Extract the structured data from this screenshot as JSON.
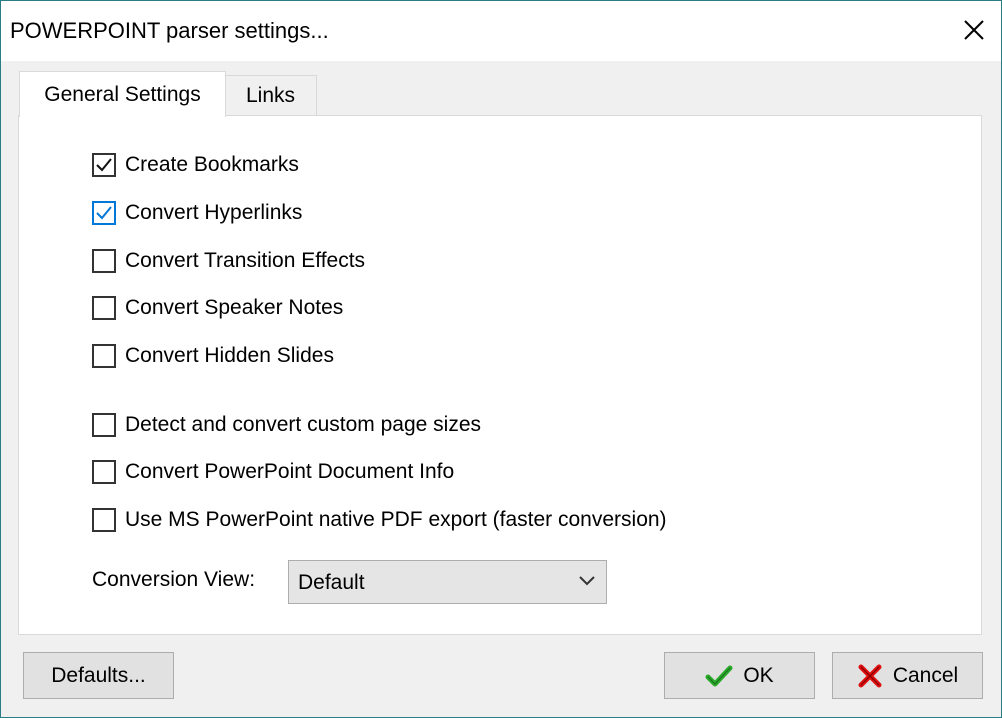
{
  "window": {
    "title": "POWERPOINT parser settings...",
    "close_icon": "close-icon"
  },
  "tabs": [
    {
      "label": "General Settings",
      "selected": true
    },
    {
      "label": "Links",
      "selected": false
    }
  ],
  "options": [
    {
      "label": "Create Bookmarks",
      "checked": true
    },
    {
      "label": "Convert Hyperlinks",
      "checked": true
    },
    {
      "label": "Convert Transition Effects",
      "checked": false
    },
    {
      "label": "Convert Speaker Notes",
      "checked": false
    },
    {
      "label": "Convert Hidden Slides",
      "checked": false
    },
    {
      "label": "Detect and convert custom page sizes",
      "checked": false
    },
    {
      "label": "Convert PowerPoint Document Info",
      "checked": false
    },
    {
      "label": "Use MS PowerPoint native PDF export (faster conversion)",
      "checked": false
    }
  ],
  "conversion_view": {
    "label": "Conversion View:",
    "value": "Default"
  },
  "buttons": {
    "defaults": "Defaults...",
    "ok": "OK",
    "cancel": "Cancel"
  },
  "colors": {
    "window_border": "#2a7d86",
    "focus_blue": "#0078d7",
    "ok_green": "#2bab2b",
    "cancel_red": "#e01010"
  }
}
